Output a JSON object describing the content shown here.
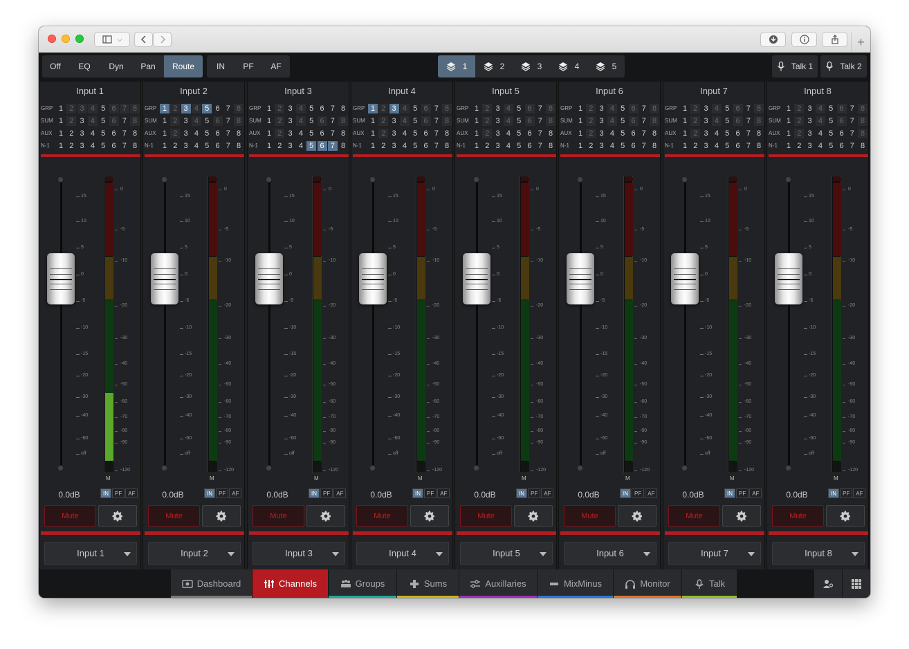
{
  "toolbar": {
    "modes": [
      {
        "label": "Off",
        "active": false
      },
      {
        "label": "EQ",
        "active": false
      },
      {
        "label": "Dyn",
        "active": false
      },
      {
        "label": "Pan",
        "active": false
      },
      {
        "label": "Route",
        "active": true
      }
    ],
    "monitor_points": [
      {
        "label": "IN"
      },
      {
        "label": "PF"
      },
      {
        "label": "AF"
      }
    ],
    "layers": [
      {
        "label": "1",
        "active": true
      },
      {
        "label": "2",
        "active": false
      },
      {
        "label": "3",
        "active": false
      },
      {
        "label": "4",
        "active": false
      },
      {
        "label": "5",
        "active": false
      }
    ],
    "talk": [
      {
        "label": "Talk 1"
      },
      {
        "label": "Talk 2"
      }
    ]
  },
  "route_labels": [
    "GRP",
    "SUM",
    "AUX",
    "N-1"
  ],
  "route_numbers": [
    "1",
    "2",
    "3",
    "4",
    "5",
    "6",
    "7",
    "8"
  ],
  "fader_scale": [
    "15",
    "10",
    "5",
    "0",
    "-5",
    "-10",
    "-15",
    "-20",
    "-30",
    "-40",
    "-60",
    "off"
  ],
  "meter_scale": [
    "0",
    "-5",
    "-10",
    "-20",
    "-30",
    "-40",
    "-50",
    "-60",
    "-70",
    "-80",
    "-90",
    "-120"
  ],
  "meter_label": "M",
  "ipa_labels": [
    "IN",
    "PF",
    "AF"
  ],
  "mute_label": "Mute",
  "channels": [
    {
      "name": "Input 1",
      "gain": "0.0dB",
      "source": "Input 1",
      "meter_level": 0.24,
      "routes": {
        "GRP": [
          0,
          1,
          1,
          1,
          0,
          1,
          1,
          1
        ],
        "SUM": [
          0,
          1,
          0,
          1,
          0,
          1,
          0,
          1
        ],
        "AUX": [
          0,
          0,
          0,
          0,
          0,
          0,
          0,
          0
        ],
        "N1": [
          0,
          0,
          0,
          0,
          0,
          0,
          0,
          0
        ]
      },
      "on": {
        "GRP": [
          0,
          0,
          0,
          0,
          0,
          0,
          0,
          0
        ],
        "SUM": [
          0,
          0,
          0,
          0,
          0,
          0,
          0,
          0
        ],
        "AUX": [
          0,
          0,
          0,
          0,
          0,
          0,
          0,
          0
        ],
        "N1": [
          0,
          0,
          0,
          0,
          0,
          0,
          0,
          0
        ]
      }
    },
    {
      "name": "Input 2",
      "gain": "0.0dB",
      "source": "Input 2",
      "meter_level": 0,
      "routes": {
        "GRP": [
          0,
          1,
          0,
          1,
          0,
          0,
          0,
          1
        ],
        "SUM": [
          0,
          1,
          0,
          1,
          0,
          1,
          0,
          1
        ],
        "AUX": [
          0,
          1,
          0,
          0,
          0,
          0,
          0,
          0
        ],
        "N1": [
          0,
          0,
          0,
          0,
          0,
          0,
          0,
          0
        ]
      },
      "on": {
        "GRP": [
          1,
          0,
          1,
          0,
          1,
          0,
          0,
          0
        ],
        "SUM": [
          0,
          0,
          0,
          0,
          0,
          0,
          0,
          0
        ],
        "AUX": [
          0,
          0,
          0,
          0,
          0,
          0,
          0,
          0
        ],
        "N1": [
          0,
          0,
          0,
          0,
          0,
          0,
          0,
          0
        ]
      }
    },
    {
      "name": "Input 3",
      "gain": "0.0dB",
      "source": "Input 3",
      "meter_level": 0,
      "routes": {
        "GRP": [
          0,
          1,
          0,
          1,
          0,
          0,
          0,
          0
        ],
        "SUM": [
          0,
          1,
          0,
          1,
          0,
          1,
          0,
          1
        ],
        "AUX": [
          0,
          1,
          0,
          0,
          0,
          0,
          0,
          0
        ],
        "N1": [
          0,
          0,
          0,
          0,
          0,
          0,
          0,
          0
        ]
      },
      "on": {
        "GRP": [
          0,
          0,
          0,
          0,
          0,
          0,
          0,
          0
        ],
        "SUM": [
          0,
          0,
          0,
          0,
          0,
          0,
          0,
          0
        ],
        "AUX": [
          0,
          0,
          0,
          0,
          0,
          0,
          0,
          0
        ],
        "N1": [
          0,
          0,
          0,
          0,
          1,
          1,
          1,
          0
        ]
      }
    },
    {
      "name": "Input 4",
      "gain": "0.0dB",
      "source": "Input 4",
      "meter_level": 0,
      "routes": {
        "GRP": [
          0,
          1,
          0,
          1,
          0,
          1,
          0,
          1
        ],
        "SUM": [
          0,
          1,
          0,
          1,
          0,
          1,
          0,
          1
        ],
        "AUX": [
          0,
          1,
          0,
          0,
          0,
          0,
          0,
          0
        ],
        "N1": [
          0,
          0,
          0,
          0,
          0,
          0,
          0,
          0
        ]
      },
      "on": {
        "GRP": [
          1,
          0,
          1,
          0,
          0,
          0,
          0,
          0
        ],
        "SUM": [
          0,
          0,
          0,
          0,
          0,
          0,
          0,
          0
        ],
        "AUX": [
          0,
          0,
          0,
          0,
          0,
          0,
          0,
          0
        ],
        "N1": [
          0,
          0,
          0,
          0,
          0,
          0,
          0,
          0
        ]
      }
    },
    {
      "name": "Input 5",
      "gain": "0.0dB",
      "source": "Input 5",
      "meter_level": 0,
      "routes": {
        "GRP": [
          0,
          1,
          0,
          1,
          0,
          1,
          0,
          1
        ],
        "SUM": [
          0,
          1,
          0,
          1,
          0,
          1,
          0,
          1
        ],
        "AUX": [
          0,
          1,
          0,
          0,
          0,
          0,
          0,
          0
        ],
        "N1": [
          0,
          0,
          0,
          0,
          0,
          0,
          0,
          0
        ]
      },
      "on": {
        "GRP": [
          0,
          0,
          0,
          0,
          0,
          0,
          0,
          0
        ],
        "SUM": [
          0,
          0,
          0,
          0,
          0,
          0,
          0,
          0
        ],
        "AUX": [
          0,
          0,
          0,
          0,
          0,
          0,
          0,
          0
        ],
        "N1": [
          0,
          0,
          0,
          0,
          0,
          0,
          0,
          0
        ]
      }
    },
    {
      "name": "Input 6",
      "gain": "0.0dB",
      "source": "Input 6",
      "meter_level": 0,
      "routes": {
        "GRP": [
          0,
          1,
          0,
          1,
          0,
          1,
          0,
          1
        ],
        "SUM": [
          0,
          1,
          0,
          1,
          0,
          1,
          0,
          1
        ],
        "AUX": [
          0,
          1,
          0,
          0,
          0,
          0,
          0,
          0
        ],
        "N1": [
          0,
          0,
          0,
          0,
          0,
          0,
          0,
          0
        ]
      },
      "on": {
        "GRP": [
          0,
          0,
          0,
          0,
          0,
          0,
          0,
          0
        ],
        "SUM": [
          0,
          0,
          0,
          0,
          0,
          0,
          0,
          0
        ],
        "AUX": [
          0,
          0,
          0,
          0,
          0,
          0,
          0,
          0
        ],
        "N1": [
          0,
          0,
          0,
          0,
          0,
          0,
          0,
          0
        ]
      }
    },
    {
      "name": "Input 7",
      "gain": "0.0dB",
      "source": "Input 7",
      "meter_level": 0,
      "routes": {
        "GRP": [
          0,
          1,
          0,
          1,
          0,
          1,
          0,
          1
        ],
        "SUM": [
          0,
          1,
          0,
          1,
          0,
          1,
          0,
          1
        ],
        "AUX": [
          0,
          1,
          0,
          0,
          0,
          0,
          0,
          0
        ],
        "N1": [
          0,
          0,
          0,
          0,
          0,
          0,
          0,
          0
        ]
      },
      "on": {
        "GRP": [
          0,
          0,
          0,
          0,
          0,
          0,
          0,
          0
        ],
        "SUM": [
          0,
          0,
          0,
          0,
          0,
          0,
          0,
          0
        ],
        "AUX": [
          0,
          0,
          0,
          0,
          0,
          0,
          0,
          0
        ],
        "N1": [
          0,
          0,
          0,
          0,
          0,
          0,
          0,
          0
        ]
      }
    },
    {
      "name": "Input 8",
      "gain": "0.0dB",
      "source": "Input 8",
      "meter_level": 0,
      "routes": {
        "GRP": [
          0,
          1,
          0,
          1,
          0,
          1,
          0,
          1
        ],
        "SUM": [
          0,
          1,
          0,
          1,
          0,
          1,
          0,
          1
        ],
        "AUX": [
          0,
          1,
          0,
          0,
          0,
          0,
          0,
          1
        ],
        "N1": [
          0,
          0,
          0,
          0,
          0,
          0,
          0,
          0
        ]
      },
      "on": {
        "GRP": [
          0,
          0,
          0,
          0,
          0,
          0,
          0,
          0
        ],
        "SUM": [
          0,
          0,
          0,
          0,
          0,
          0,
          0,
          0
        ],
        "AUX": [
          0,
          0,
          0,
          0,
          0,
          0,
          0,
          0
        ],
        "N1": [
          0,
          0,
          0,
          0,
          0,
          0,
          0,
          0
        ]
      }
    }
  ],
  "bottom_tabs": [
    {
      "label": "Dashboard",
      "icon": "dashboard-icon",
      "color": "#7a7a7a",
      "active": false
    },
    {
      "label": "Channels",
      "icon": "channels-icon",
      "color": "#b51b21",
      "active": true
    },
    {
      "label": "Groups",
      "icon": "groups-icon",
      "color": "#1fa89c",
      "active": false
    },
    {
      "label": "Sums",
      "icon": "plus-icon",
      "color": "#c8b41a",
      "active": false
    },
    {
      "label": "Auxillaries",
      "icon": "aux-icon",
      "color": "#9b2fc0",
      "active": false
    },
    {
      "label": "MixMinus",
      "icon": "minus-icon",
      "color": "#2a78d6",
      "active": false
    },
    {
      "label": "Monitor",
      "icon": "headphones-icon",
      "color": "#e0762a",
      "active": false
    },
    {
      "label": "Talk",
      "icon": "microphone-icon",
      "color": "#8fc02a",
      "active": false
    }
  ],
  "colors": {
    "accent": "#566b80",
    "mute": "#b31d22"
  }
}
